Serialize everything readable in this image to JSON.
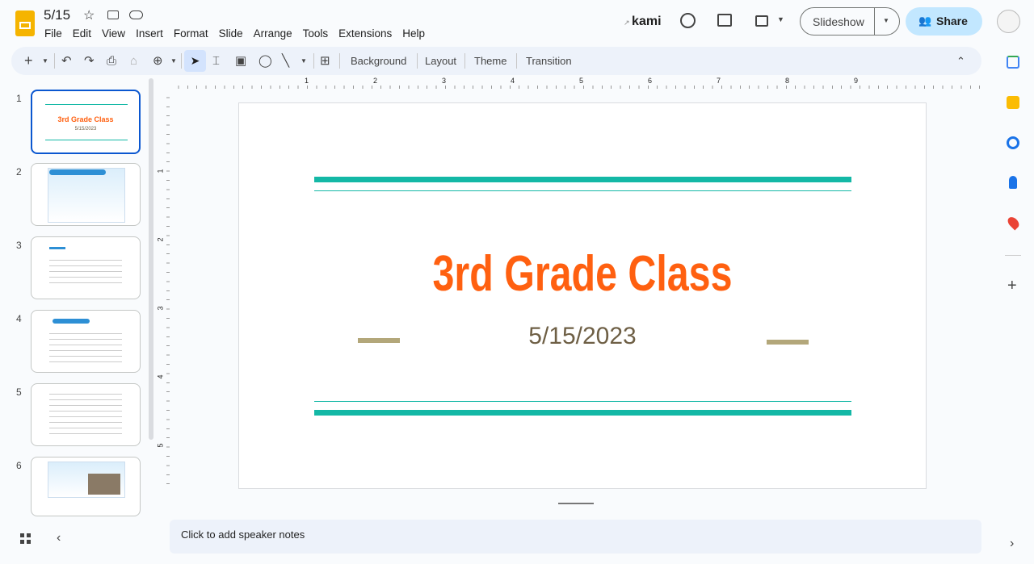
{
  "header": {
    "title": "5/15",
    "menu": [
      "File",
      "Edit",
      "View",
      "Insert",
      "Format",
      "Slide",
      "Arrange",
      "Tools",
      "Extensions",
      "Help"
    ],
    "kami": "kami",
    "slideshow": "Slideshow",
    "share": "Share"
  },
  "toolbar": {
    "background": "Background",
    "layout": "Layout",
    "theme": "Theme",
    "transition": "Transition"
  },
  "ruler": {
    "h": [
      "1",
      "2",
      "3",
      "4",
      "5",
      "6",
      "7",
      "8",
      "9"
    ],
    "v": [
      "1",
      "2",
      "3",
      "4",
      "5"
    ]
  },
  "filmstrip": {
    "numbers": [
      "1",
      "2",
      "3",
      "4",
      "5",
      "6"
    ],
    "thumb1_title": "3rd Grade Class",
    "thumb1_date": "5/15/2023"
  },
  "slide": {
    "title": "3rd Grade Class",
    "date": "5/15/2023",
    "colors": {
      "title": "#ff6010",
      "teal": "#14b8a6",
      "date": "#6e5f45",
      "dash": "#b3a77a"
    }
  },
  "notes": {
    "placeholder": "Click to add speaker notes"
  }
}
